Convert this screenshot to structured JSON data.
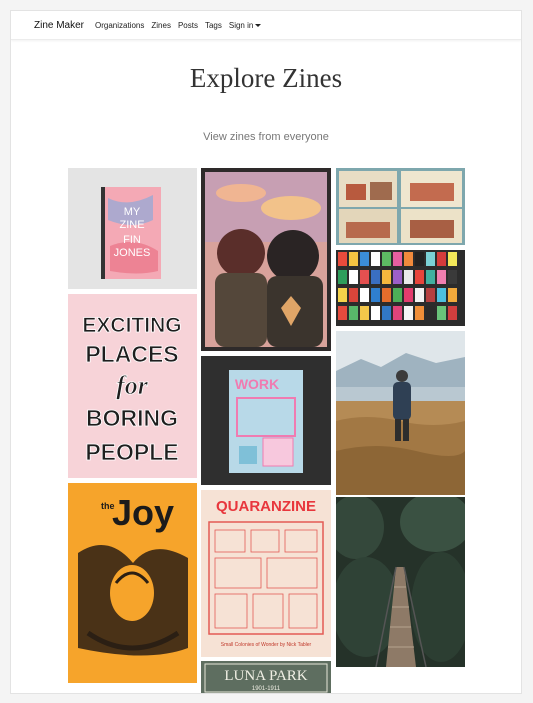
{
  "nav": {
    "brand": "Zine Maker",
    "links": [
      "Organizations",
      "Zines",
      "Posts",
      "Tags"
    ],
    "signin": "Sign in"
  },
  "header": {
    "title": "Explore Zines",
    "subtitle": "View zines from everyone"
  },
  "zines": {
    "my_zine": {
      "line1": "MY",
      "line2": "ZINE",
      "line3": "FIN",
      "line4": "JONES"
    },
    "exciting": {
      "l1": "EXCITING",
      "l2": "PLACES",
      "l3": "for",
      "l4": "BORING",
      "l5": "PEOPLE"
    },
    "joy": {
      "small": "the",
      "big": "Joy"
    },
    "work": {
      "title": "WORK"
    },
    "quaranzine": {
      "title": "QUARANZINE",
      "footer": "Small Colonies of Wonder by Nick Tabler"
    },
    "luna": {
      "title": "LUNA PARK",
      "years": "1901-1911"
    }
  },
  "colors": {
    "accent": "#f6a42b",
    "pink": "#f7d3d8",
    "dark": "#2f2f2f"
  }
}
